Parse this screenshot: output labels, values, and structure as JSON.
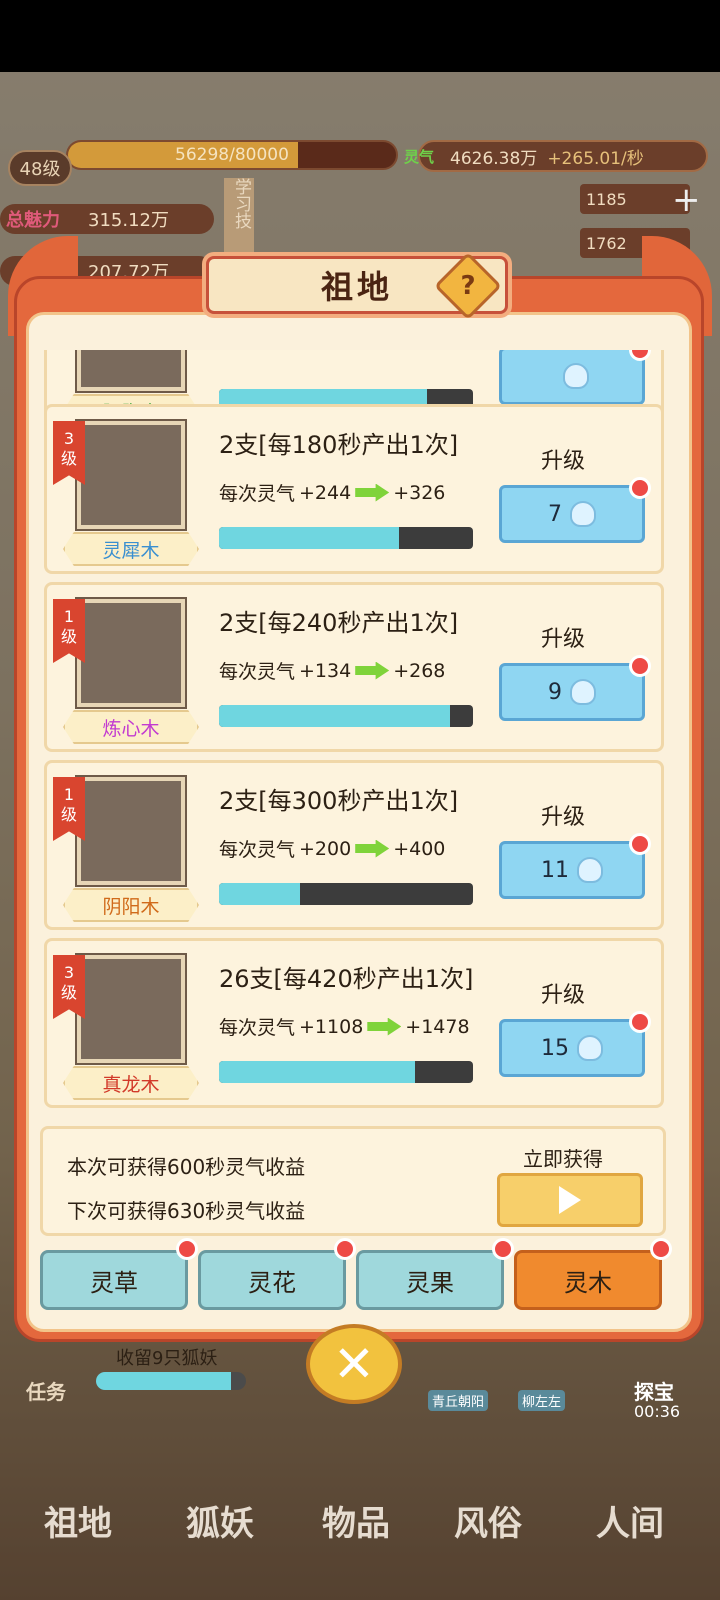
{
  "hud": {
    "level": "48级",
    "exp_text": "56298/80000",
    "exp_progress": 0.7,
    "qi_label": "灵气",
    "qi_value": "4626.38万",
    "qi_rate": "+265.01/秒",
    "charm_label": "总魅力",
    "charm_value": "315.12万",
    "charm2_value": "207.72万",
    "study_tab": "学习技",
    "res1": "1185",
    "res2": "1762",
    "plus": "+"
  },
  "modal": {
    "title": "祖地",
    "help": "?"
  },
  "colors": {
    "accent": "#e4683d",
    "progress": "#6fd6e0",
    "red_dot": "#ee4a46"
  },
  "items": [
    {
      "level_num": "",
      "level_unit": "",
      "name": "胭脂木",
      "name_color": "#3aa83a",
      "title": "",
      "per_label": "",
      "from": "",
      "to": "",
      "progress": 0.82,
      "upgrade_label": "",
      "cost": "",
      "partial": true
    },
    {
      "level_num": "3",
      "level_unit": "级",
      "name": "灵犀木",
      "name_color": "#3a8fd0",
      "title": "2支[每180秒产出1次]",
      "per_label": "每次灵气",
      "from": "+244",
      "to": "+326",
      "progress": 0.71,
      "upgrade_label": "升级",
      "cost": "7",
      "partial": false
    },
    {
      "level_num": "1",
      "level_unit": "级",
      "name": "炼心木",
      "name_color": "#c23ad0",
      "title": "2支[每240秒产出1次]",
      "per_label": "每次灵气",
      "from": "+134",
      "to": "+268",
      "progress": 0.91,
      "upgrade_label": "升级",
      "cost": "9",
      "partial": false
    },
    {
      "level_num": "1",
      "level_unit": "级",
      "name": "阴阳木",
      "name_color": "#d06a1a",
      "title": "2支[每300秒产出1次]",
      "per_label": "每次灵气",
      "from": "+200",
      "to": "+400",
      "progress": 0.32,
      "upgrade_label": "升级",
      "cost": "11",
      "partial": false
    },
    {
      "level_num": "3",
      "level_unit": "级",
      "name": "真龙木",
      "name_color": "#d23a2a",
      "title": "26支[每420秒产出1次]",
      "per_label": "每次灵气",
      "from": "+1108",
      "to": "+1478",
      "progress": 0.77,
      "upgrade_label": "升级",
      "cost": "15",
      "partial": false
    }
  ],
  "reward": {
    "line1": "本次可获得600秒灵气收益",
    "line2": "下次可获得630秒灵气收益",
    "claim_label": "立即获得"
  },
  "tabs": [
    {
      "label": "灵草",
      "active": false
    },
    {
      "label": "灵花",
      "active": false
    },
    {
      "label": "灵果",
      "active": false
    },
    {
      "label": "灵木",
      "active": true
    }
  ],
  "bottom": {
    "task": "任务",
    "fox_text": "收留9只狐妖",
    "fox_progress": 0.9,
    "tag1": "青丘朝阳",
    "tag2": "柳左左",
    "chest": "探宝",
    "timer": "00:36",
    "nav": [
      "祖地",
      "狐妖",
      "物品",
      "风俗",
      "人间"
    ]
  }
}
